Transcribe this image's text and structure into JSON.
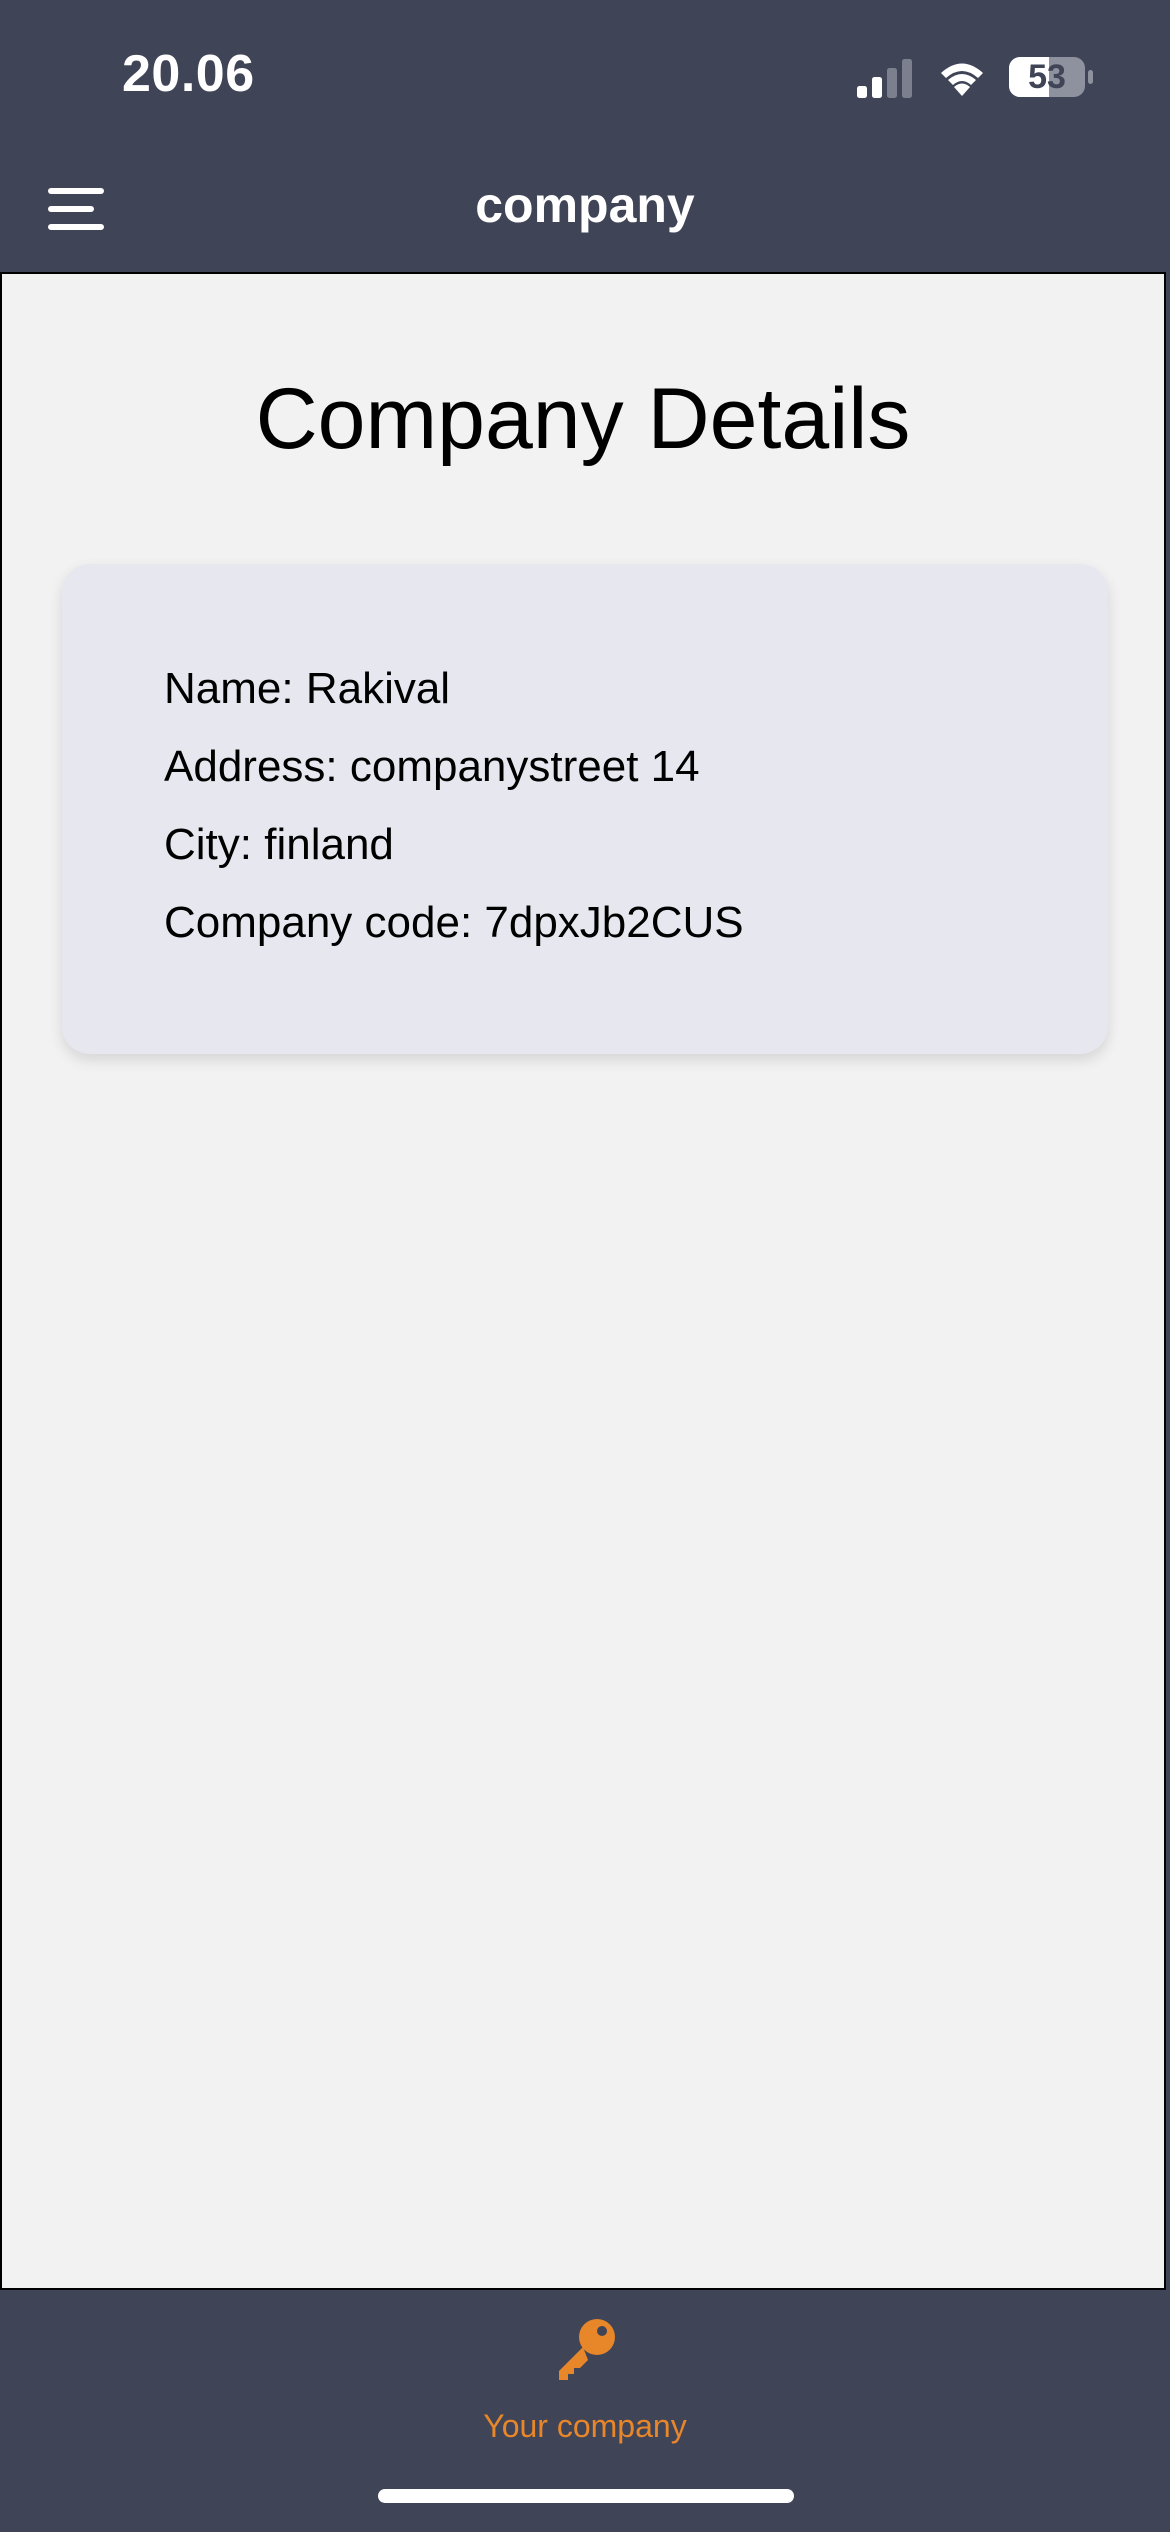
{
  "status_bar": {
    "time": "20.06",
    "battery_level": "53",
    "icons": [
      "signal-icon",
      "wifi-icon",
      "battery-icon"
    ]
  },
  "nav_bar": {
    "title": "company",
    "menu_icon": "hamburger-menu-icon"
  },
  "main": {
    "title": "Company Details",
    "details": [
      "Name: Rakival",
      "Address: companystreet 14",
      "City: finland",
      "Company code: 7dpxJb2CUS"
    ]
  },
  "tab_bar": {
    "items": [
      {
        "label": "Your company",
        "icon": "key-icon",
        "active": true
      }
    ]
  },
  "colors": {
    "bar_background": "#404457",
    "content_background": "#f2f2f2",
    "card_background": "#e7e8ef",
    "accent": "#e8862a"
  }
}
